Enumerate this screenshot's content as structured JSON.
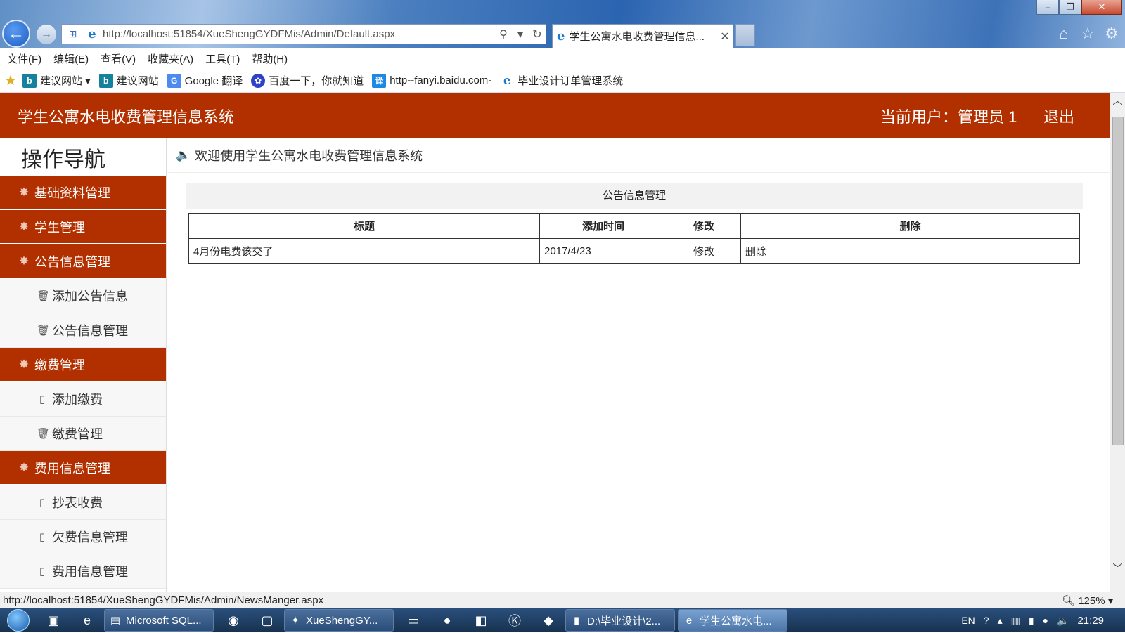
{
  "browser": {
    "url": "http://localhost:51854/XueShengGYDFMis/Admin/Default.aspx",
    "tab_title": "学生公寓水电收费管理信息...",
    "menu": [
      "文件(F)",
      "编辑(E)",
      "查看(V)",
      "收藏夹(A)",
      "工具(T)",
      "帮助(H)"
    ],
    "favorites": [
      {
        "label": "建议网站 ▾",
        "icon": "b"
      },
      {
        "label": "建议网站",
        "icon": "b"
      },
      {
        "label": "Google 翻译",
        "icon": "g"
      },
      {
        "label": "百度一下，你就知道",
        "icon": "paw"
      },
      {
        "label": "http--fanyi.baidu.com-",
        "icon": "yi"
      },
      {
        "label": "毕业设计订单管理系统",
        "icon": "ie"
      }
    ],
    "status_url": "http://localhost:51854/XueShengGYDFMis/Admin/NewsManger.aspx",
    "zoom": "125%"
  },
  "header": {
    "title": "学生公寓水电收费管理信息系统",
    "current_user": "当前用户：管理员 1",
    "logout": "退出"
  },
  "sidebar": {
    "title": "操作导航",
    "groups": [
      {
        "label": "基础资料管理",
        "items": []
      },
      {
        "label": "学生管理",
        "items": []
      },
      {
        "label": "公告信息管理",
        "items": [
          {
            "label": "添加公告信息",
            "icon": "trash-icon"
          },
          {
            "label": "公告信息管理",
            "icon": "trash-icon"
          }
        ]
      },
      {
        "label": "缴费管理",
        "items": [
          {
            "label": "添加缴费",
            "icon": "file-icon"
          },
          {
            "label": "缴费管理",
            "icon": "trash-icon"
          }
        ]
      },
      {
        "label": "费用信息管理",
        "items": [
          {
            "label": "抄表收费",
            "icon": "file-icon"
          },
          {
            "label": "欠费信息管理",
            "icon": "file-icon"
          },
          {
            "label": "费用信息管理",
            "icon": "file-icon"
          }
        ]
      }
    ]
  },
  "main": {
    "welcome": "欢迎使用学生公寓水电收费管理信息系统",
    "panel_title": "公告信息管理",
    "table": {
      "headers": [
        "标题",
        "添加时间",
        "修改",
        "删除"
      ],
      "rows": [
        [
          "4月份电费该交了",
          "2017/4/23",
          "修改",
          "删除"
        ]
      ]
    }
  },
  "taskbar": {
    "tasks": [
      {
        "label": "Microsoft SQL...",
        "active": false
      },
      {
        "label": "XueShengGY...",
        "active": false
      },
      {
        "label": "D:\\毕业设计\\2...",
        "active": false
      },
      {
        "label": "学生公寓水电...",
        "active": true
      }
    ],
    "lang": "EN",
    "clock": "21:29"
  }
}
